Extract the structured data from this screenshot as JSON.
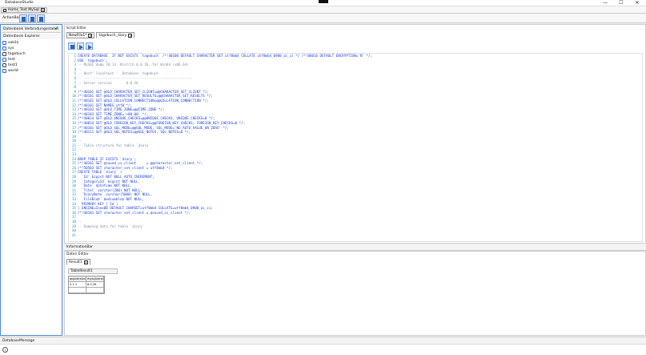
{
  "app": {
    "title": "DatabaseStudio"
  },
  "window_controls": {
    "minimize": "—",
    "maximize": "☐",
    "close": "✕"
  },
  "app_tabs": [
    {
      "label": "Home"
    },
    {
      "label": "Test MySql"
    }
  ],
  "actionbar": {
    "label": "ActionBar"
  },
  "left_panel": {
    "connection_status_label": "Datenbank Verbindungsstatus",
    "explorer_label": "Datenbank Explorer",
    "databases": [
      "sakila",
      "sys",
      "tagebuch",
      "test",
      "test1",
      "world"
    ]
  },
  "script_editor": {
    "title": "Script Editor",
    "tabs": [
      {
        "label": "NewFile1*"
      },
      {
        "label": "tagebuch_diary"
      }
    ],
    "lines": [
      {
        "n": "1",
        "t": "CREATE DATABASE  IF NOT EXISTS `tagebuch` /*!40100 DEFAULT CHARACTER SET utf8mb4 COLLATE utf8mb4_0900_ai_ci */ /*!80016 DEFAULT ENCRYPTION='N' */;"
      },
      {
        "n": "2",
        "t": "USE `tagebuch`;"
      },
      {
        "n": "3",
        "t": "-- MySQL dump 10.13  Distrib 8.0.26, for Win64 (x86_64)",
        "c": true
      },
      {
        "n": "4",
        "t": "--",
        "c": true
      },
      {
        "n": "5",
        "t": "-- Host: localhost    Database: tagebuch",
        "c": true
      },
      {
        "n": "6",
        "t": "-- ------------------------------------------------------",
        "c": true
      },
      {
        "n": "7",
        "t": "-- Server version\t8.0.26",
        "c": true
      },
      {
        "n": "8",
        "t": ""
      },
      {
        "n": "9",
        "t": "/*!40101 SET @OLD_CHARACTER_SET_CLIENT=@@CHARACTER_SET_CLIENT */;"
      },
      {
        "n": "10",
        "t": "/*!40101 SET @OLD_CHARACTER_SET_RESULTS=@@CHARACTER_SET_RESULTS */;"
      },
      {
        "n": "11",
        "t": "/*!40101 SET @OLD_COLLATION_CONNECTION=@@COLLATION_CONNECTION */;"
      },
      {
        "n": "12",
        "t": "/*!40101 SET NAMES utf8 */;"
      },
      {
        "n": "13",
        "t": "/*!40103 SET @OLD_TIME_ZONE=@@TIME_ZONE */;"
      },
      {
        "n": "14",
        "t": "/*!40103 SET TIME_ZONE='+00:00' */;"
      },
      {
        "n": "15",
        "t": "/*!40014 SET @OLD_UNIQUE_CHECKS=@@UNIQUE_CHECKS, UNIQUE_CHECKS=0 */;"
      },
      {
        "n": "16",
        "t": "/*!40014 SET @OLD_FOREIGN_KEY_CHECKS=@@FOREIGN_KEY_CHECKS, FOREIGN_KEY_CHECKS=0 */;"
      },
      {
        "n": "17",
        "t": "/*!40101 SET @OLD_SQL_MODE=@@SQL_MODE, SQL_MODE='NO_AUTO_VALUE_ON_ZERO' */;"
      },
      {
        "n": "18",
        "t": "/*!40111 SET @OLD_SQL_NOTES=@@SQL_NOTES, SQL_NOTES=0 */;"
      },
      {
        "n": "19",
        "t": ""
      },
      {
        "n": "20",
        "t": "--",
        "c": true
      },
      {
        "n": "21",
        "t": "-- Table structure for table `diary`",
        "c": true
      },
      {
        "n": "22",
        "t": "--",
        "c": true
      },
      {
        "n": "23",
        "t": ""
      },
      {
        "n": "24",
        "t": "DROP TABLE IF EXISTS `diary`;"
      },
      {
        "n": "25",
        "t": "/*!40101 SET @saved_cs_client     = @@character_set_client */;"
      },
      {
        "n": "26",
        "t": "/*!50503 SET character_set_client = utf8mb4 */;"
      },
      {
        "n": "27",
        "t": "CREATE TABLE `diary` ("
      },
      {
        "n": "28",
        "t": "  `Id` bigint NOT NULL AUTO_INCREMENT,"
      },
      {
        "n": "29",
        "t": "  `CategoryId` bigint NOT NULL,"
      },
      {
        "n": "30",
        "t": "  `Date` datetime NOT NULL,"
      },
      {
        "n": "31",
        "t": "  `Titel` varchar(200) NOT NULL,"
      },
      {
        "n": "32",
        "t": "  `DiaryNote` varchar(5000) NOT NULL,"
      },
      {
        "n": "33",
        "t": "  `FileBlob` mediumblob NOT NULL,"
      },
      {
        "n": "34",
        "t": "  PRIMARY KEY (`Id`)"
      },
      {
        "n": "35",
        "t": ") ENGINE=InnoDB DEFAULT CHARSET=utf8mb4 COLLATE=utf8mb4_0900_ai_ci;"
      },
      {
        "n": "36",
        "t": "/*!40101 SET character_set_client = @saved_cs_client */;"
      },
      {
        "n": "37",
        "t": ""
      },
      {
        "n": "38",
        "t": "--",
        "c": true
      },
      {
        "n": "39",
        "t": "-- Dumping data for table `diary`",
        "c": true
      },
      {
        "n": "40",
        "t": "--",
        "c": true
      },
      {
        "n": "41",
        "t": ""
      }
    ]
  },
  "information_bar": {
    "label": "InformationBar"
  },
  "daten_editor": {
    "title": "Daten Editor",
    "tab_label": "Result1",
    "table_header": "TableResult1",
    "columns": [
      "appversion",
      "mysqlversion"
    ],
    "rows": [
      [
        "2.1.1",
        "8.0.26"
      ]
    ]
  },
  "message_bar": {
    "label": "DatabaseMessage"
  },
  "status": {
    "icon_glyph": "i"
  }
}
